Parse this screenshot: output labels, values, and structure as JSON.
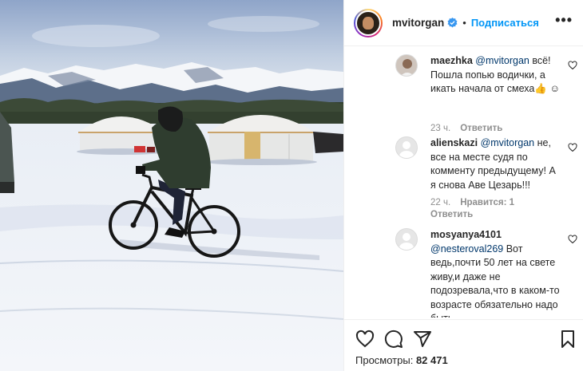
{
  "header": {
    "username": "mvitorgan",
    "separator": "•",
    "follow_label": "Подписаться",
    "more_label": "•••"
  },
  "comments": [
    {
      "user": "maezhka",
      "mention": "@mvitorgan",
      "text": " всё! Пошла попью водички, а икать начала от смеха👍 ☺︎",
      "time": "23 ч.",
      "likes": "",
      "reply": "Ответить"
    },
    {
      "user": "alienskazi",
      "mention": "@mvitorgan",
      "text": " не, все на месте судя по комменту предыдущему! А я снова Аве Цезарь!!!",
      "time": "22 ч.",
      "likes": "Нравится: 1",
      "reply": "Ответить"
    },
    {
      "user": "mosyanya4101",
      "mention": "@nesteroval269",
      "text": " Вот ведь,почти 50 лет на свете живу,и даже не подозревала,что в каком-то возрасте обязательно надо быть",
      "time": "",
      "likes": "",
      "reply": ""
    }
  ],
  "footer": {
    "views_label": "Просмотры:",
    "views_count": "82 471"
  },
  "icons": {
    "verified": "verified-badge-icon",
    "like": "heart-icon",
    "comment": "comment-bubble-icon",
    "share": "paper-plane-icon",
    "save": "bookmark-icon",
    "comment_like": "small-heart-icon"
  },
  "colors": {
    "accent": "#0095f6",
    "mention": "#00376b",
    "meta": "#8e8e8e",
    "verified": "#3897f0"
  }
}
